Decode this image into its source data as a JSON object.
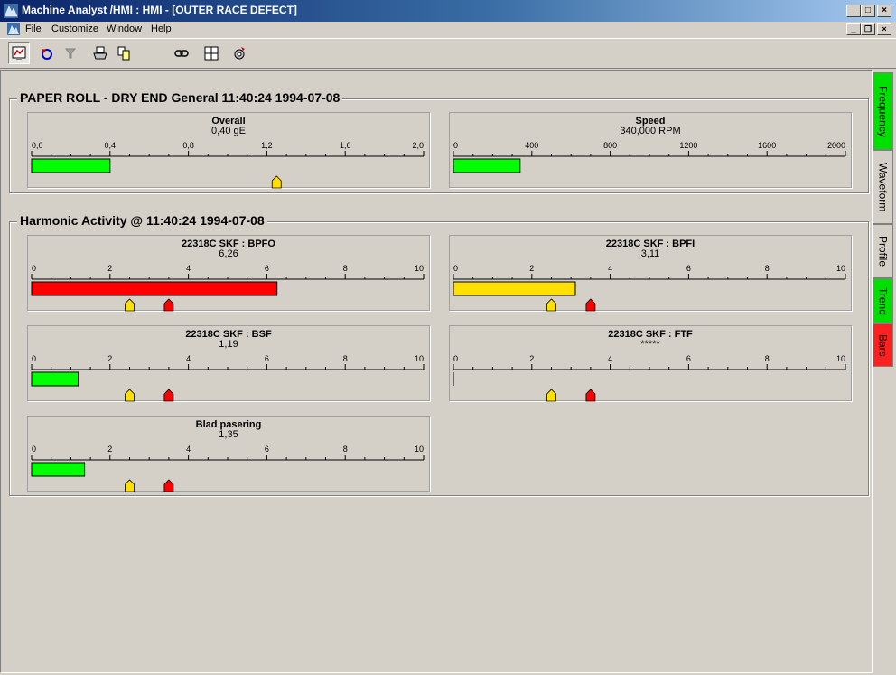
{
  "window": {
    "title": "Machine Analyst /HMI : HMI - [OUTER RACE DEFECT]",
    "caption_buttons": [
      "_",
      "□",
      "×"
    ]
  },
  "menubar": {
    "items": [
      "File",
      "Customize",
      "Window",
      "Help"
    ],
    "mdi_buttons": [
      "_",
      "❐",
      "×"
    ]
  },
  "toolbar": {
    "buttons": [
      "display-icon",
      "undo-icon",
      "filter-icon",
      "printer-icon",
      "copy-icon",
      "link-icon",
      "layout-icon",
      "settings-icon"
    ]
  },
  "colors": {
    "green": "#00ff00",
    "red": "#ff0000",
    "yellow": "#ffe000",
    "tab_green": "#00e000",
    "tab_red": "#ff2020"
  },
  "groups": [
    {
      "title": "PAPER ROLL - DRY END General 11:40:24 1994-07-08"
    },
    {
      "title": "Harmonic Activity @ 11:40:24 1994-07-08"
    }
  ],
  "panels": [
    {
      "id": "overall",
      "title": "Overall",
      "value": "0,40 gE",
      "ticks": [
        "0,0",
        "0,4",
        "0,8",
        "1,2",
        "1,6",
        "2,0"
      ],
      "min": 0,
      "max": 2,
      "bar": 0.4,
      "bar_color": "#00ff00",
      "alerts": [
        {
          "value": 1.25,
          "color": "#ffe000"
        }
      ]
    },
    {
      "id": "speed",
      "title": "Speed",
      "value": "340,000 RPM",
      "ticks": [
        "0",
        "400",
        "800",
        "1200",
        "1600",
        "2000"
      ],
      "min": 0,
      "max": 2000,
      "bar": 340,
      "bar_color": "#00ff00",
      "alerts": []
    },
    {
      "id": "bpfo",
      "title": "22318C SKF : BPFO",
      "value": "6,26",
      "ticks": [
        "0",
        "2",
        "4",
        "6",
        "8",
        "10"
      ],
      "min": 0,
      "max": 10,
      "bar": 6.26,
      "bar_color": "#ff0000",
      "alerts": [
        {
          "value": 2.5,
          "color": "#ffe000"
        },
        {
          "value": 3.5,
          "color": "#ff0000"
        }
      ]
    },
    {
      "id": "bpfi",
      "title": "22318C SKF : BPFI",
      "value": "3,11",
      "ticks": [
        "0",
        "2",
        "4",
        "6",
        "8",
        "10"
      ],
      "min": 0,
      "max": 10,
      "bar": 3.11,
      "bar_color": "#ffe000",
      "alerts": [
        {
          "value": 2.5,
          "color": "#ffe000"
        },
        {
          "value": 3.5,
          "color": "#ff0000"
        }
      ]
    },
    {
      "id": "bsf",
      "title": "22318C SKF : BSF",
      "value": "1,19",
      "ticks": [
        "0",
        "2",
        "4",
        "6",
        "8",
        "10"
      ],
      "min": 0,
      "max": 10,
      "bar": 1.19,
      "bar_color": "#00ff00",
      "alerts": [
        {
          "value": 2.5,
          "color": "#ffe000"
        },
        {
          "value": 3.5,
          "color": "#ff0000"
        }
      ]
    },
    {
      "id": "ftf",
      "title": "22318C SKF : FTF",
      "value": "*****",
      "ticks": [
        "0",
        "2",
        "4",
        "6",
        "8",
        "10"
      ],
      "min": 0,
      "max": 10,
      "bar": 0,
      "bar_color": "#00ff00",
      "alerts": [
        {
          "value": 2.5,
          "color": "#ffe000"
        },
        {
          "value": 3.5,
          "color": "#ff0000"
        }
      ]
    },
    {
      "id": "blad",
      "title": "Blad pasering",
      "value": "1,35",
      "ticks": [
        "0",
        "2",
        "4",
        "6",
        "8",
        "10"
      ],
      "min": 0,
      "max": 10,
      "bar": 1.35,
      "bar_color": "#00ff00",
      "alerts": [
        {
          "value": 2.5,
          "color": "#ffe000"
        },
        {
          "value": 3.5,
          "color": "#ff0000"
        }
      ]
    }
  ],
  "side_tabs": [
    {
      "label": "Frequency",
      "color": "#00e000"
    },
    {
      "label": "Waveform",
      "color": ""
    },
    {
      "label": "Profile",
      "color": ""
    },
    {
      "label": "Trend",
      "color": "#00e000"
    },
    {
      "label": "Bars",
      "color": "#ff2020"
    }
  ]
}
